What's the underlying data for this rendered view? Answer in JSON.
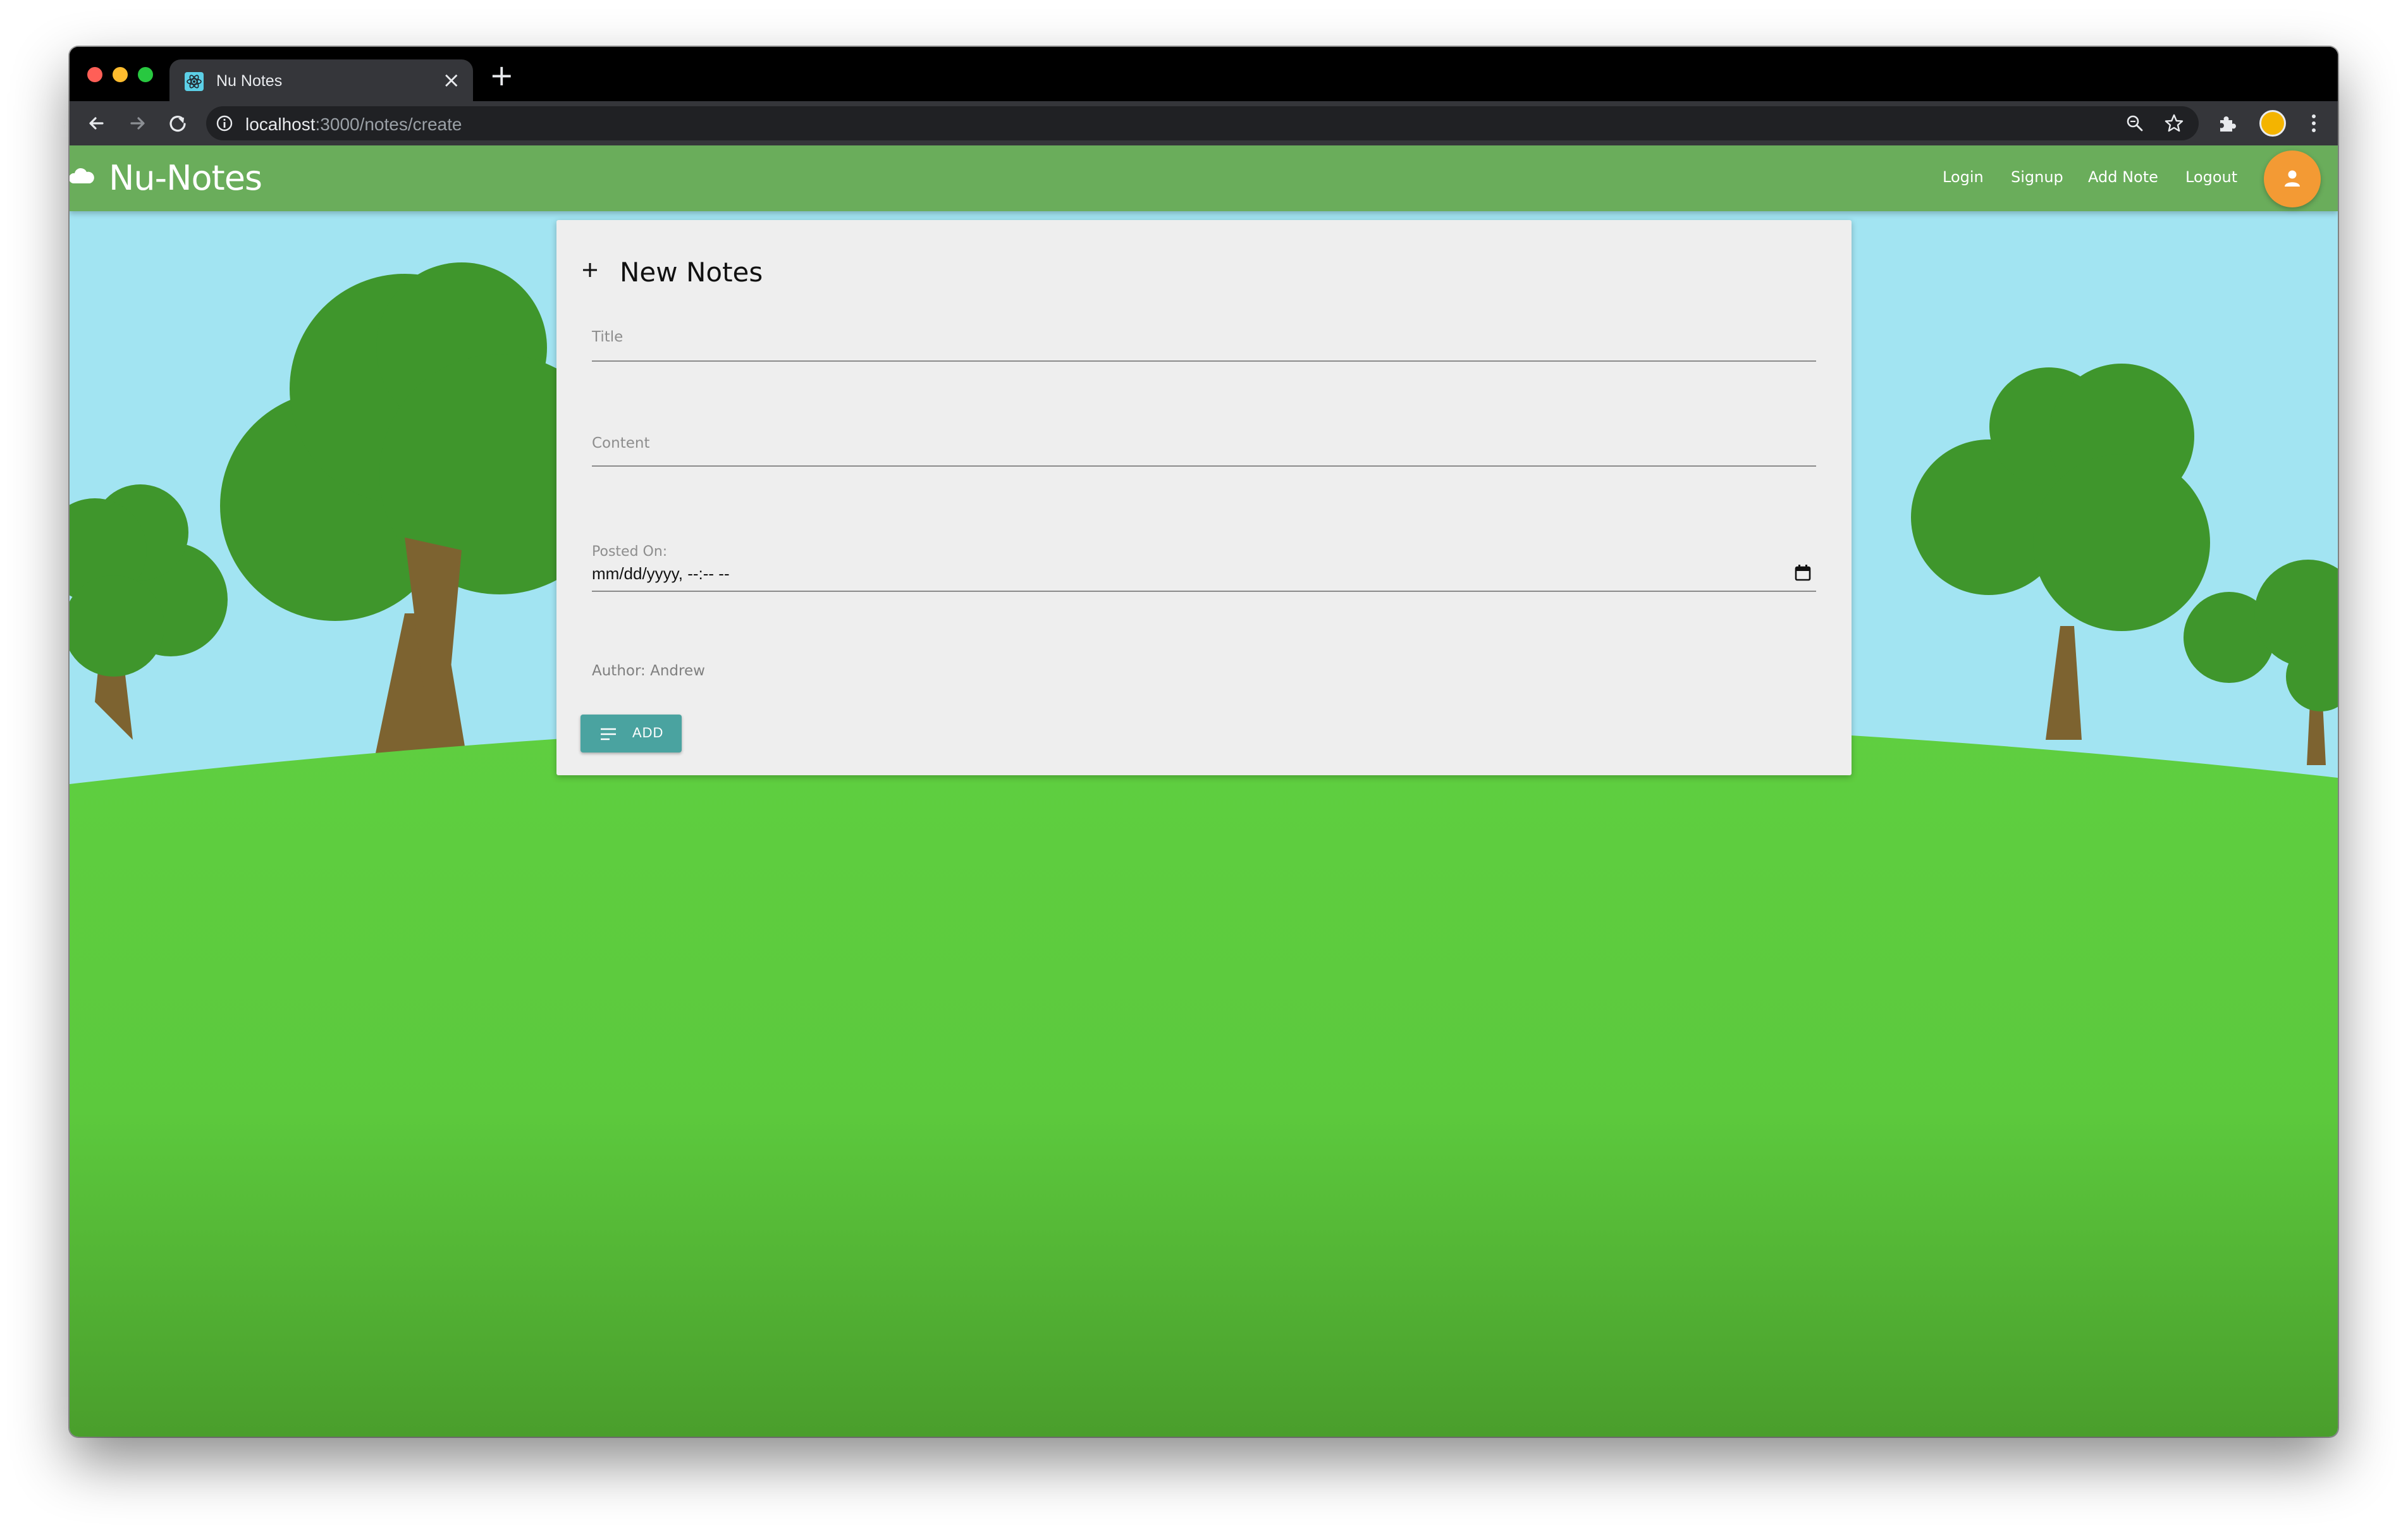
{
  "browser": {
    "tab_title": "Nu Notes",
    "tab_close_glyph": "×",
    "new_tab_glyph": "+",
    "url_host": "localhost",
    "url_path": ":3000/notes/create",
    "icons": [
      "back-icon",
      "forward-icon",
      "reload-icon",
      "info-icon",
      "zoom-icon",
      "star-icon",
      "extensions-icon",
      "profile-icon",
      "menu-icon"
    ]
  },
  "app": {
    "brand": "Nu-Notes",
    "nav": {
      "login": "Login",
      "signup": "Signup",
      "add_note": "Add Note",
      "logout": "Logout"
    },
    "colors": {
      "appbar": "#6aad5b",
      "avatar": "#f39a34",
      "sky": "#a2e4f2",
      "grass": "#5fcf40",
      "tree": "#3f962c",
      "trunk": "#7d6330",
      "button": "#4aa3a0"
    }
  },
  "form": {
    "heading": "New Notes",
    "title_label": "Title",
    "content_label": "Content",
    "posted_label": "Posted On:",
    "posted_value": "mm/dd/yyyy, --:-- --",
    "author": "Author: Andrew",
    "add_button": "ADD"
  }
}
